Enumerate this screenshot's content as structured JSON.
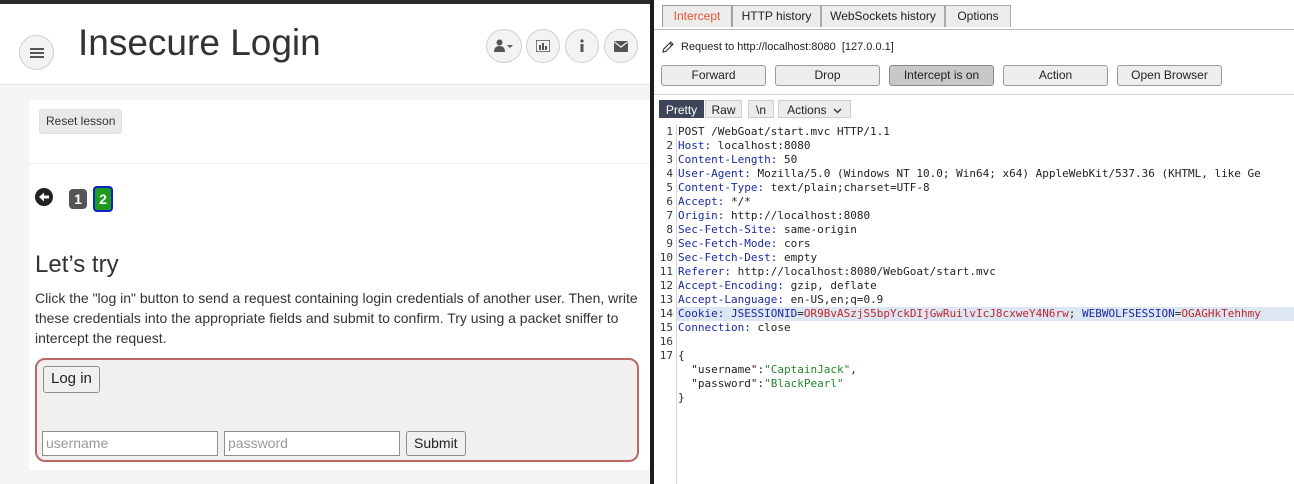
{
  "webgoat": {
    "title": "Insecure Login",
    "reset_label": "Reset lesson",
    "pages": [
      "1",
      "2"
    ],
    "heading": "Let’s try",
    "description": "Click the \"log in\" button to send a request containing login credentials of another user. Then, write these credentials into the appropriate fields and submit to confirm. Try using a packet sniffer to intercept the request.",
    "login_label": "Log in",
    "username_placeholder": "username",
    "password_placeholder": "password",
    "submit_label": "Submit"
  },
  "burp": {
    "tabs": [
      "Intercept",
      "HTTP history",
      "WebSockets history",
      "Options"
    ],
    "request_info": "Request to http://localhost:8080  [127.0.0.1]",
    "buttons": {
      "forward": "Forward",
      "drop": "Drop",
      "intercept": "Intercept is on",
      "action": "Action",
      "open_browser": "Open Browser"
    },
    "view_tabs": {
      "pretty": "Pretty",
      "raw": "Raw",
      "newline": "\\n",
      "actions": "Actions"
    },
    "line_numbers": [
      "1",
      "2",
      "3",
      "4",
      "5",
      "6",
      "7",
      "8",
      "9",
      "10",
      "11",
      "12",
      "13",
      "14",
      "15",
      "16",
      "17"
    ],
    "request_line": "POST /WebGoat/start.mvc HTTP/1.1",
    "headers": [
      {
        "name": "Host",
        "value": "localhost:8080"
      },
      {
        "name": "Content-Length",
        "value": "50"
      },
      {
        "name": "User-Agent",
        "value": "Mozilla/5.0 (Windows NT 10.0; Win64; x64) AppleWebKit/537.36 (KHTML, like Ge"
      },
      {
        "name": "Content-Type",
        "value": "text/plain;charset=UTF-8"
      },
      {
        "name": "Accept",
        "value": "*/*"
      },
      {
        "name": "Origin",
        "value": "http://localhost:8080"
      },
      {
        "name": "Sec-Fetch-Site",
        "value": "same-origin"
      },
      {
        "name": "Sec-Fetch-Mode",
        "value": "cors"
      },
      {
        "name": "Sec-Fetch-Dest",
        "value": "empty"
      },
      {
        "name": "Referer",
        "value": "http://localhost:8080/WebGoat/start.mvc"
      },
      {
        "name": "Accept-Encoding",
        "value": "gzip, deflate"
      },
      {
        "name": "Accept-Language",
        "value": "en-US,en;q=0.9"
      }
    ],
    "cookie": {
      "name": "Cookie",
      "jsession_name": "JSESSIONID",
      "jsession_value": "OR9BvASzjS5bpYckDIjGwRuilvIcJ8cxweY4N6rw",
      "webwolf_name": "WEBWOLFSESSION",
      "webwolf_value": "OGAGHkTehhmy"
    },
    "connection": {
      "name": "Connection",
      "value": "close"
    },
    "body": {
      "open": "{",
      "username_key": "\"username\"",
      "username_value": "\"CaptainJack\"",
      "password_key": "\"password\"",
      "password_value": "\"BlackPearl\"",
      "close": "}"
    }
  }
}
